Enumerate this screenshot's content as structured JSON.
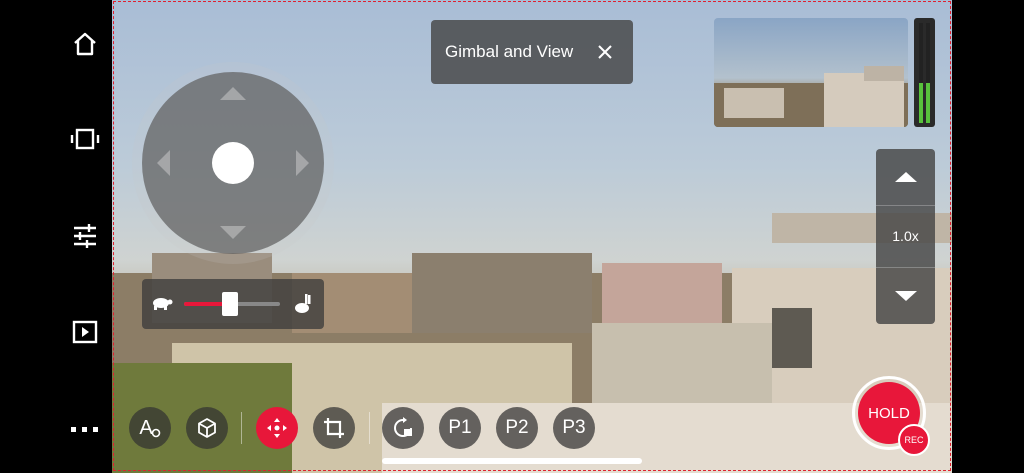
{
  "title_card": {
    "text": "Gimbal and View",
    "close_icon": "close-icon"
  },
  "zoom": {
    "level": "1.0x",
    "up_icon": "chevron-up-icon",
    "down_icon": "chevron-down-icon"
  },
  "speed_slider": {
    "value_fraction": 0.48,
    "slow_icon": "turtle-icon",
    "fast_icon": "rabbit-icon"
  },
  "sidebar": [
    {
      "icon": "home-icon"
    },
    {
      "icon": "orientation-icon"
    },
    {
      "icon": "sliders-icon"
    },
    {
      "icon": "playback-icon"
    },
    {
      "icon": "more-icon"
    }
  ],
  "toolbar": {
    "ai_label": "A",
    "p1": "P1",
    "p2": "P2",
    "p3": "P3"
  },
  "record": {
    "hold_label": "HOLD",
    "rec_label": "REC"
  },
  "colors": {
    "accent": "#e8173a",
    "panel": "#464646"
  }
}
